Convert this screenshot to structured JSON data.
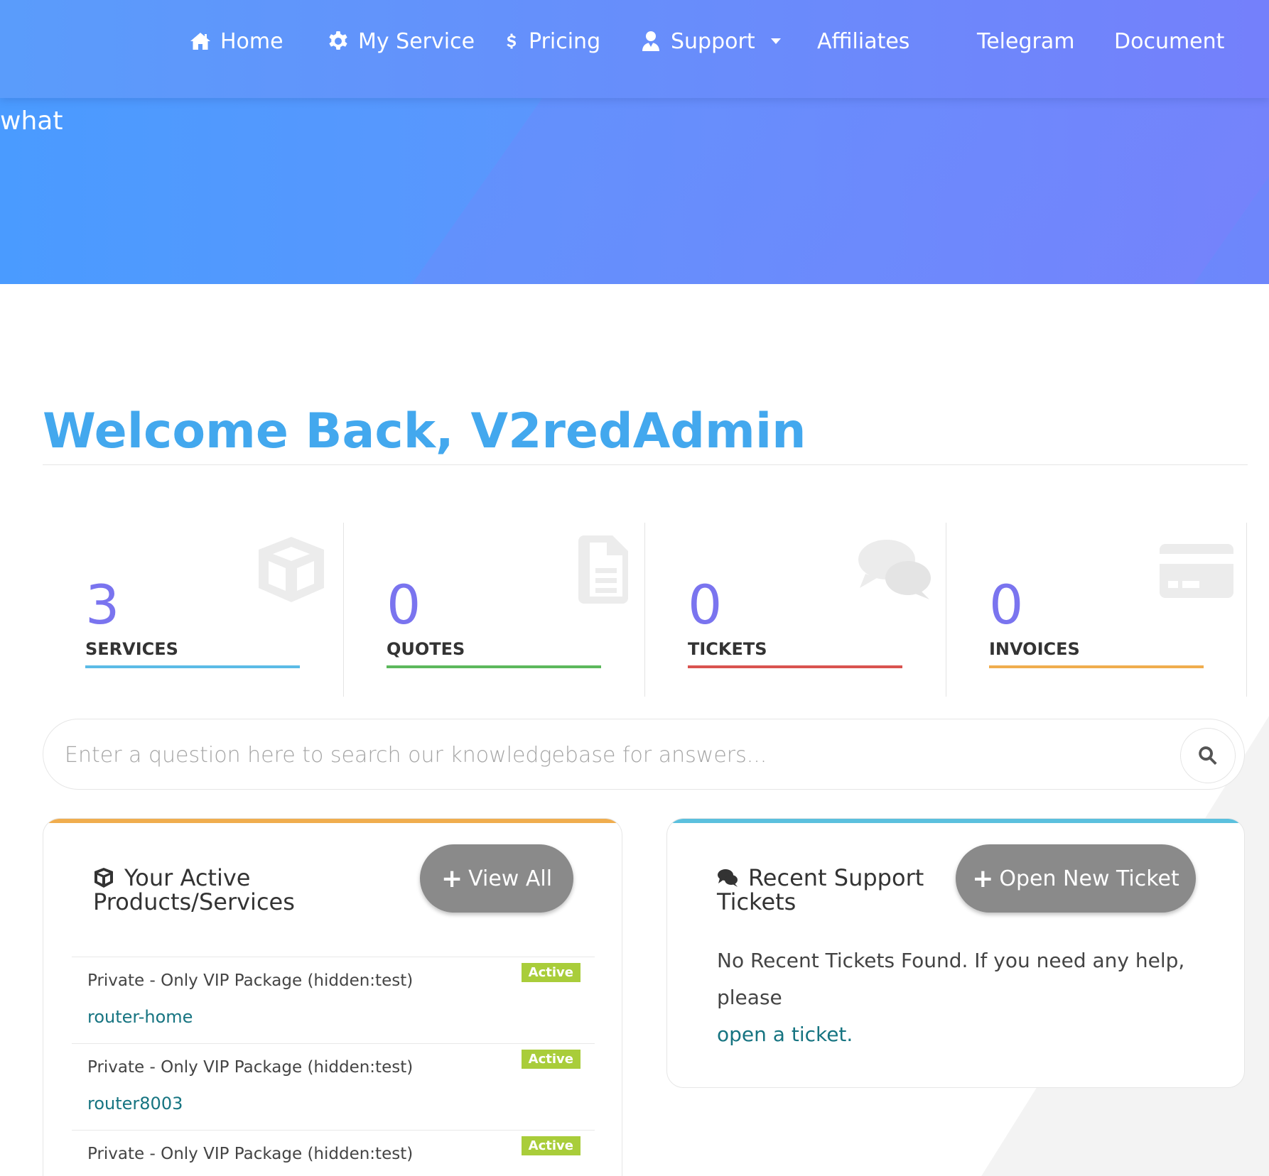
{
  "nav": {
    "items": [
      {
        "label": "Home",
        "icon": "home-icon"
      },
      {
        "label": "My Service",
        "icon": "gear-icon"
      },
      {
        "label": "Pricing",
        "icon": "dollar-icon"
      },
      {
        "label": "Support",
        "icon": "user-tie-icon",
        "has_dropdown": true
      },
      {
        "label": "Affiliates"
      },
      {
        "label": "Telegram"
      },
      {
        "label": "Document"
      }
    ]
  },
  "hero": {
    "text": "what"
  },
  "welcome": {
    "title": "Welcome Back, V2redAdmin"
  },
  "stats": [
    {
      "value": "3",
      "label": "SERVICES",
      "color": "#5bbbe6",
      "icon": "cube-icon"
    },
    {
      "value": "0",
      "label": "QUOTES",
      "color": "#5cb85c",
      "icon": "document-icon"
    },
    {
      "value": "0",
      "label": "TICKETS",
      "color": "#d9534f",
      "icon": "comments-icon"
    },
    {
      "value": "0",
      "label": "INVOICES",
      "color": "#f0ad4e",
      "icon": "credit-card-icon"
    }
  ],
  "search": {
    "placeholder": "Enter a question here to search our knowledgebase for answers..."
  },
  "services_panel": {
    "title_line1": "Your Active",
    "title_line2": "Products/Services",
    "button_label": "View All",
    "accent": "#f0ad4e",
    "items": [
      {
        "name": "Private - Only VIP Package (hidden:test)",
        "domain": "router-home",
        "status": "Active"
      },
      {
        "name": "Private - Only VIP Package (hidden:test)",
        "domain": "router8003",
        "status": "Active"
      },
      {
        "name": "Private - Only VIP Package (hidden:test)",
        "domain": "",
        "status": "Active"
      }
    ]
  },
  "tickets_panel": {
    "title_line1": "Recent Support",
    "title_line2": "Tickets",
    "button_label": "Open New Ticket",
    "accent": "#5bc0de",
    "message": "No Recent Tickets Found. If you need any help, please",
    "link_text": "open a ticket."
  },
  "colors": {
    "welcome": "#43a8ee",
    "stat_number": "#7a74ef",
    "badge_active": "#a9cd3a",
    "link": "#167481"
  }
}
